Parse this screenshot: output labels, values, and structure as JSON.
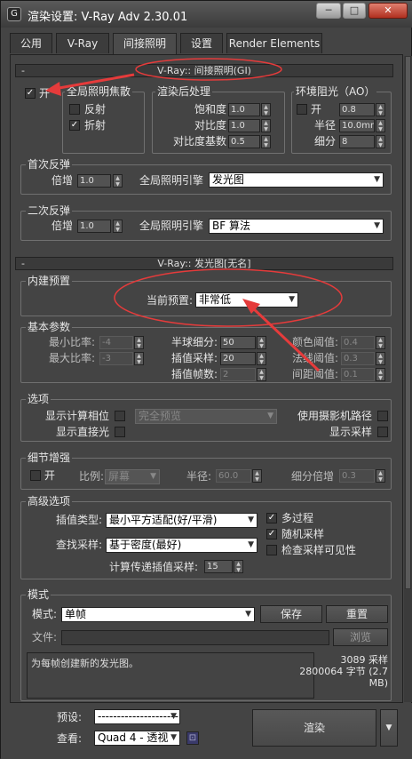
{
  "window": {
    "title": "渲染设置: V-Ray Adv 2.30.01"
  },
  "tabs": [
    "公用",
    "V-Ray",
    "间接照明",
    "设置",
    "Render Elements"
  ],
  "gi": {
    "rollout_title": "V-Ray:: 间接照明(GI)",
    "on_label": "开",
    "caustics": {
      "title": "全局照明焦散",
      "reflect": "反射",
      "refract": "折射"
    },
    "post": {
      "title": "渲染后处理",
      "saturation_label": "饱和度",
      "saturation": "1.0",
      "contrast_label": "对比度",
      "contrast": "1.0",
      "contrast_base_label": "对比度基数",
      "contrast_base": "0.5"
    },
    "ao": {
      "title": "环境阻光（AO）",
      "on_label": "开",
      "on_value": "0.8",
      "radius_label": "半径",
      "radius": "10.0mm",
      "subdivs_label": "细分",
      "subdivs": "8"
    },
    "primary": {
      "title": "首次反弹",
      "mult_label": "倍增",
      "mult": "1.0",
      "engine_label": "全局照明引擎",
      "engine": "发光图"
    },
    "secondary": {
      "title": "二次反弹",
      "mult_label": "倍增",
      "mult": "1.0",
      "engine_label": "全局照明引擎",
      "engine": "BF 算法"
    }
  },
  "irradiance": {
    "rollout_title": "V-Ray:: 发光图[无名]",
    "preset": {
      "title": "内建预置",
      "current_label": "当前预置:",
      "current": "非常低"
    },
    "basic": {
      "title": "基本参数",
      "min_rate_label": "最小比率:",
      "min_rate": "-4",
      "max_rate_label": "最大比率:",
      "max_rate": "-3",
      "hsph_label": "半球细分:",
      "hsph": "50",
      "interp_label": "插值采样:",
      "interp": "20",
      "interp_frames_label": "插值帧数:",
      "interp_frames": "2",
      "clr_thresh_label": "颜色阈值:",
      "clr_thresh": "0.4",
      "nrm_thresh_label": "法线阈值:",
      "nrm_thresh": "0.3",
      "dist_thresh_label": "间距阈值:",
      "dist_thresh": "0.1"
    },
    "options": {
      "title": "选项",
      "show_calc": "显示计算相位",
      "show_direct": "显示直接光",
      "preview_mode": "完全预览",
      "use_cam_path": "使用摄影机路径",
      "show_samples": "显示采样"
    },
    "detail": {
      "title": "细节增强",
      "on_label": "开",
      "scale_label": "比例:",
      "scale": "屏幕",
      "radius_label": "半径:",
      "radius": "60.0",
      "subdiv_mult_label": "细分倍增",
      "subdiv_mult": "0.3"
    },
    "advanced": {
      "title": "高级选项",
      "interp_type_label": "插值类型:",
      "interp_type": "最小平方适配(好/平滑)",
      "lookup_label": "查找采样:",
      "lookup": "基于密度(最好)",
      "calc_pass_label": "计算传递插值采样:",
      "calc_pass": "15",
      "multipass": "多过程",
      "randomize": "随机采样",
      "check_vis": "检查采样可见性"
    },
    "mode": {
      "title": "模式",
      "mode_label": "模式:",
      "mode": "单帧",
      "save": "保存",
      "reset": "重置",
      "file_label": "文件:",
      "browse": "浏览",
      "description": "为每帧创建新的发光图。",
      "samples": "3089 采样",
      "bytes": "2800064 字节 (2.7",
      "mb": "MB)"
    }
  },
  "bottom": {
    "preset_label": "预设:",
    "preset_value": "---------------------",
    "view_label": "查看:",
    "view_value": "Quad 4 - 透视",
    "render": "渲染"
  },
  "colors": {
    "annotation": "#e53b3b",
    "panel": "#444444"
  }
}
